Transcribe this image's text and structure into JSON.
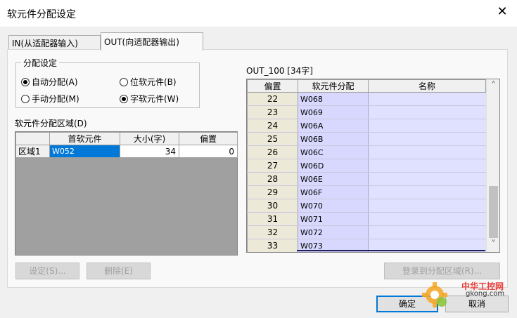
{
  "window": {
    "title": "软元件分配设定",
    "close_glyph": "✕"
  },
  "tabs": [
    {
      "label": "IN(从适配器输入)"
    },
    {
      "label": "OUT(向适配器输出)"
    }
  ],
  "alloc_setting": {
    "title": "分配设定",
    "options": [
      {
        "label": "自动分配(A)",
        "selected": true
      },
      {
        "label": "位软元件(B)",
        "selected": false
      },
      {
        "label": "手动分配(M)",
        "selected": false
      },
      {
        "label": "字软元件(W)",
        "selected": true
      }
    ]
  },
  "area_table": {
    "title": "软元件分配区域(D)",
    "columns": [
      "",
      "首软元件",
      "大小(字)",
      "偏置"
    ],
    "rows": [
      {
        "area": "区域1",
        "first_device": "W052",
        "size": "34",
        "offset": "0"
      }
    ]
  },
  "out_table": {
    "title": "OUT_100 [34字]",
    "columns": [
      "偏置",
      "软元件分配",
      "名称"
    ],
    "rows": [
      {
        "offset": "22",
        "device": "W068",
        "name": ""
      },
      {
        "offset": "23",
        "device": "W069",
        "name": ""
      },
      {
        "offset": "24",
        "device": "W06A",
        "name": ""
      },
      {
        "offset": "25",
        "device": "W06B",
        "name": ""
      },
      {
        "offset": "26",
        "device": "W06C",
        "name": ""
      },
      {
        "offset": "27",
        "device": "W06D",
        "name": ""
      },
      {
        "offset": "28",
        "device": "W06E",
        "name": ""
      },
      {
        "offset": "29",
        "device": "W06F",
        "name": ""
      },
      {
        "offset": "30",
        "device": "W070",
        "name": ""
      },
      {
        "offset": "31",
        "device": "W071",
        "name": ""
      },
      {
        "offset": "32",
        "device": "W072",
        "name": ""
      },
      {
        "offset": "33",
        "device": "W073",
        "name": ""
      }
    ],
    "scroll_up": "˄",
    "scroll_down": "˅"
  },
  "buttons": {
    "settings": "设定(S)...",
    "delete": "删除(E)",
    "register": "登录到分配区域(R)...",
    "ok": "确定",
    "cancel": "取消"
  },
  "watermark": {
    "text_cn": "中华工控网",
    "text_en": "gkong.com"
  },
  "colors": {
    "selection": "#0078d7",
    "device_cell": "#d8d8ff",
    "offset_cell": "#ece9d8"
  }
}
